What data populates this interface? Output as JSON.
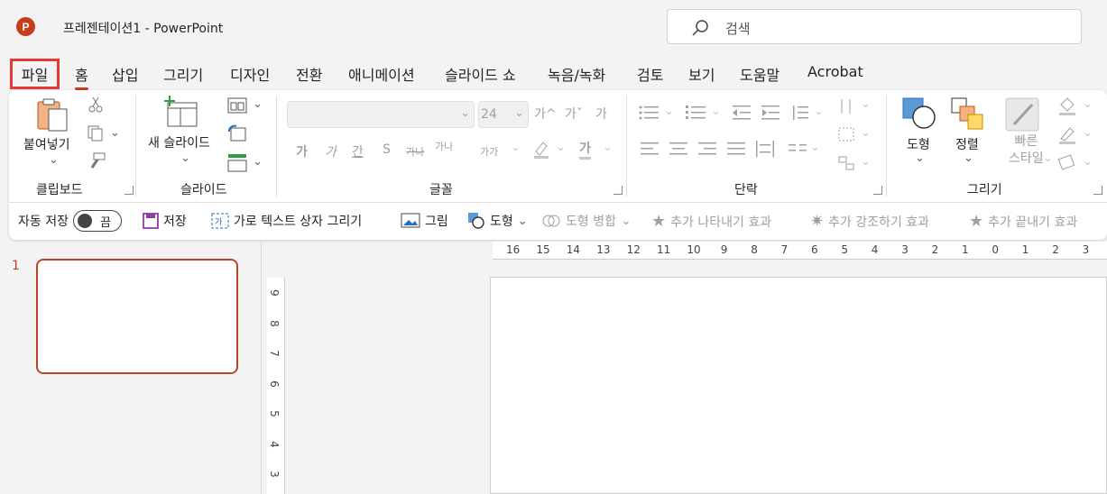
{
  "window": {
    "title": "프레젠테이션1  -  PowerPoint",
    "logo": "P"
  },
  "search": {
    "placeholder": "검색"
  },
  "menu": [
    "파일",
    "홈",
    "삽입",
    "그리기",
    "디자인",
    "전환",
    "애니메이션",
    "슬라이드 쇼",
    "녹음/녹화",
    "검토",
    "보기",
    "도움말",
    "Acrobat"
  ],
  "ribbon": {
    "clipboard": {
      "paste": "붙여넣기",
      "label": "클립보드"
    },
    "slides": {
      "new_slide": "새 슬라이드",
      "label": "슬라이드"
    },
    "font": {
      "size": "24",
      "label": "글꼴",
      "grow": "가^",
      "shrink": "가ˇ",
      "bold": "가",
      "italic": "가",
      "underline": "간",
      "shadow": "S",
      "strike": "가나",
      "spacing": "가나",
      "case": "가가",
      "font_color": "가"
    },
    "paragraph": {
      "label": "단락"
    },
    "drawing": {
      "shapes": "도형",
      "arrange": "정렬",
      "quick_styles": "빠른\n스타일",
      "label": "그리기"
    }
  },
  "quick_access": {
    "autosave": "자동 저장",
    "toggle": "끔",
    "save": "저장",
    "textbox": "가로 텍스트 상자 그리기",
    "picture": "그림",
    "shape": "도형",
    "merge": "도형 병합",
    "anim_enter": "추가 나타내기 효과",
    "anim_emph": "추가 강조하기 효과",
    "anim_exit": "추가 끝내기 효과"
  },
  "thumbnails": {
    "slide_number": "1"
  },
  "rulers": {
    "h": [
      "16",
      "15",
      "14",
      "13",
      "12",
      "11",
      "10",
      "9",
      "8",
      "7",
      "6",
      "5",
      "4",
      "3",
      "2",
      "1",
      "0",
      "1",
      "2",
      "3"
    ],
    "v": [
      "9",
      "8",
      "7",
      "6",
      "5",
      "4",
      "3"
    ]
  },
  "colors": {
    "accent": "#c43e1c",
    "highlight": "#e53935"
  }
}
